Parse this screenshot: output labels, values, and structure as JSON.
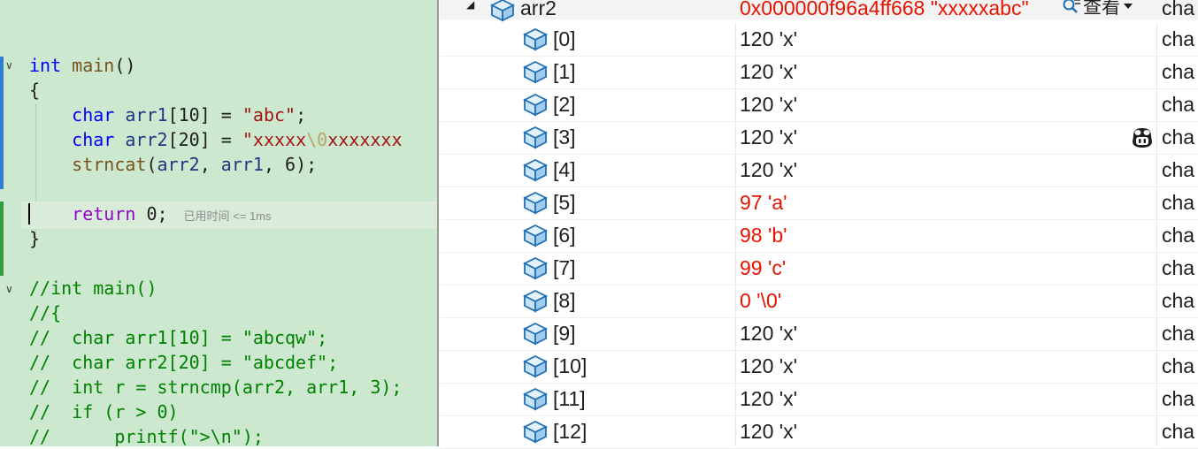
{
  "editor": {
    "main": {
      "signature": [
        "int",
        "main",
        "()"
      ],
      "open_brace": "{",
      "line1": [
        "char",
        "arr1",
        "[10] = ",
        "\"abc\"",
        ";"
      ],
      "line2": [
        "char",
        "arr2",
        "[20] = ",
        "\"xxxxx",
        "\\0",
        "xxxxxxx"
      ],
      "line3": [
        "strncat",
        "(",
        "arr2",
        ", ",
        "arr1",
        ", 6);"
      ],
      "line4": [
        "return",
        " 0;"
      ],
      "elapsed_hint": "已用时间 <= 1ms",
      "close_brace": "}"
    },
    "comment_block": [
      "//int main()",
      "//{",
      "//  char arr1[10] = \"abcqw\";",
      "//  char arr2[20] = \"abcdef\";",
      "//  int r = strncmp(arr2, arr1, 3);",
      "//  if (r > 0)",
      "//      printf(\">\\n\");"
    ],
    "fold_glyph": "∨"
  },
  "watch": {
    "parent": {
      "name": "arr2",
      "value": "0x000000f96a4ff668 \"xxxxxabc\"",
      "view_label": "查看",
      "type": "cha",
      "expander_glyph": "◢"
    },
    "rows": [
      {
        "name": "[0]",
        "value": "120 'x'",
        "changed": false,
        "type": "cha"
      },
      {
        "name": "[1]",
        "value": "120 'x'",
        "changed": false,
        "type": "cha"
      },
      {
        "name": "[2]",
        "value": "120 'x'",
        "changed": false,
        "type": "cha"
      },
      {
        "name": "[3]",
        "value": "120 'x'",
        "changed": false,
        "type": "cha"
      },
      {
        "name": "[4]",
        "value": "120 'x'",
        "changed": false,
        "type": "cha"
      },
      {
        "name": "[5]",
        "value": "97 'a'",
        "changed": true,
        "type": "cha"
      },
      {
        "name": "[6]",
        "value": "98 'b'",
        "changed": true,
        "type": "cha"
      },
      {
        "name": "[7]",
        "value": "99 'c'",
        "changed": true,
        "type": "cha"
      },
      {
        "name": "[8]",
        "value": "0 '\\0'",
        "changed": true,
        "type": "cha"
      },
      {
        "name": "[9]",
        "value": "120 'x'",
        "changed": false,
        "type": "cha"
      },
      {
        "name": "[10]",
        "value": "120 'x'",
        "changed": false,
        "type": "cha"
      },
      {
        "name": "[11]",
        "value": "120 'x'",
        "changed": false,
        "type": "cha"
      },
      {
        "name": "[12]",
        "value": "120 'x'",
        "changed": false,
        "type": "cha"
      }
    ],
    "icons": {
      "variable": "cube-icon",
      "view": "magnifier-icon",
      "dropdown": "chevron-down-icon",
      "assistant": "copilot-icon"
    },
    "colors": {
      "changed_value": "#e51400",
      "cube_fill": "#c9e3f6",
      "cube_stroke": "#1f6fb5"
    }
  }
}
